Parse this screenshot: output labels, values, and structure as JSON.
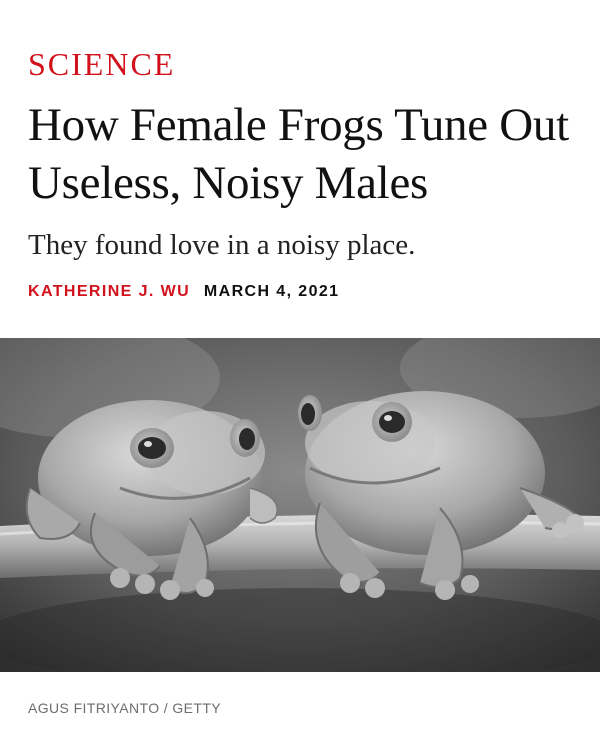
{
  "article": {
    "section": "SCIENCE",
    "headline": "How Female Frogs Tune Out Useless, Noisy Males",
    "dek": "They found love in a noisy place.",
    "author": "KATHERINE J. WU",
    "date": "MARCH 4, 2021"
  },
  "photo": {
    "credit": "AGUS FITRIYANTO / GETTY"
  },
  "colors": {
    "accent": "#d1121d",
    "text": "#111111",
    "credit": "#6e6e6e"
  }
}
